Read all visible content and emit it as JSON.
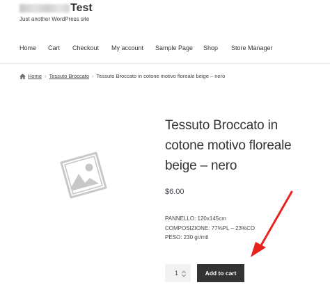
{
  "site": {
    "title_suffix": "Test",
    "tagline": "Just another WordPress site"
  },
  "nav": {
    "items": [
      "Home",
      "Cart",
      "Checkout",
      "My account",
      "Sample Page",
      "Shop",
      "Store Manager"
    ]
  },
  "breadcrumb": {
    "home": "Home",
    "category": "Tessuto Broccato",
    "current": "Tessuto Broccato in cotone motivo floreale beige – nero",
    "separator": "›"
  },
  "product": {
    "title": "Tessuto Broccato in cotone motivo floreale beige – nero",
    "price": "$6.00",
    "details": [
      "PANNELLO: 120x145cm",
      "COMPOSIZIONE: 77%PL – 23%CO",
      "PESO: 230 gr/mtl"
    ],
    "quantity": "1",
    "add_to_cart_label": "Add to cart"
  },
  "colors": {
    "button_bg": "#333333",
    "annotation_arrow": "#e8231e",
    "placeholder_gray": "#c8c8c8"
  }
}
